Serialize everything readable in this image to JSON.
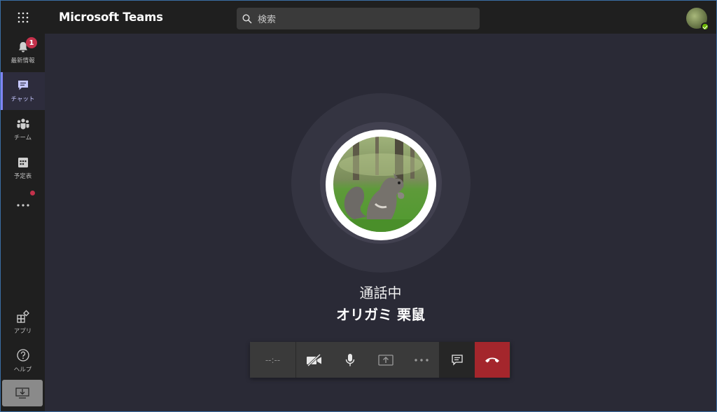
{
  "app": {
    "title": "Microsoft Teams"
  },
  "search": {
    "placeholder": "検索"
  },
  "rail": {
    "items": [
      {
        "label": "最新情報",
        "icon": "bell-icon",
        "badge": "1"
      },
      {
        "label": "チャット",
        "icon": "chat-icon",
        "active": true
      },
      {
        "label": "チーム",
        "icon": "teams-icon"
      },
      {
        "label": "予定表",
        "icon": "calendar-icon"
      },
      {
        "label": "",
        "icon": "more-icon"
      }
    ],
    "bottom_items": [
      {
        "label": "アプリ",
        "icon": "apps-icon"
      },
      {
        "label": "ヘルプ",
        "icon": "help-icon"
      }
    ]
  },
  "call": {
    "status": "通話中",
    "caller_name": "オリガミ 栗鼠",
    "timer": "--:--"
  },
  "colors": {
    "accent": "#7f85f5",
    "badge": "#c4314b",
    "hangup": "#a4262c",
    "presence_available": "#6bb700"
  }
}
